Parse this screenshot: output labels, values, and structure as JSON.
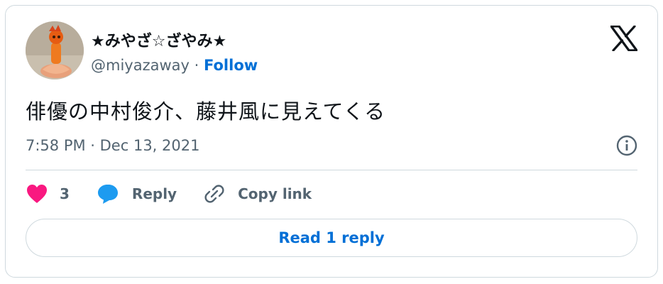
{
  "author": {
    "display_name": "★みやざ☆ざやみ★",
    "handle": "@miyazaway",
    "separator": "·",
    "follow_label": "Follow",
    "avatar_icon": "orange-figure-avatar"
  },
  "tweet": {
    "text": "俳優の中村俊介、藤井風に見えてくる",
    "timestamp": "7:58 PM · Dec 13, 2021"
  },
  "actions": {
    "like_count": "3",
    "reply_label": "Reply",
    "copy_link_label": "Copy link"
  },
  "read_replies_label": "Read 1 reply",
  "icons": {
    "brand": "x-logo-icon",
    "info": "info-icon",
    "like": "heart-icon",
    "reply": "speech-bubble-icon",
    "copy_link": "link-icon"
  },
  "colors": {
    "link": "#006fd6",
    "like": "#f91880",
    "reply": "#1d9bf0",
    "muted_text": "#536471",
    "border": "#cfd9de"
  }
}
